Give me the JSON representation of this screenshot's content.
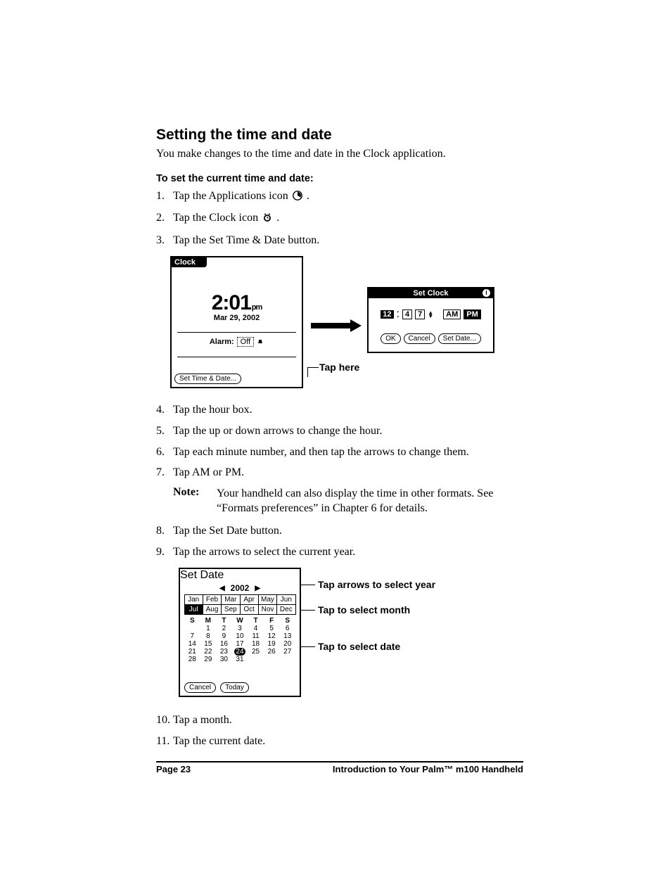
{
  "title": "Setting the time and date",
  "intro": "You make changes to the time and date in the Clock application.",
  "subheading": "To set the current time and date:",
  "steps_a": {
    "s1": "Tap the Applications icon ",
    "s1_end": ".",
    "s2": "Tap the Clock icon ",
    "s2_end": ".",
    "s3": "Tap the Set Time & Date button."
  },
  "clock_screen": {
    "title": "Clock",
    "time": "2:01",
    "ampm": "pm",
    "date": "Mar 29, 2002",
    "alarm_label": "Alarm:",
    "alarm_value": "Off",
    "button": "Set Time & Date..."
  },
  "setclock_screen": {
    "title": "Set Clock",
    "hour": "12",
    "min1": "4",
    "min2": "7",
    "am": "AM",
    "pm": "PM",
    "ok": "OK",
    "cancel": "Cancel",
    "setdate": "Set Date..."
  },
  "tap_here": "Tap here",
  "steps_b": {
    "s4": "Tap the hour box.",
    "s5": "Tap the up or down arrows to change the hour.",
    "s6": "Tap each minute number, and then tap the arrows to change them.",
    "s7": "Tap AM or PM."
  },
  "note": {
    "label": "Note:",
    "body": "Your handheld can also display the time in other formats. See “Formats preferences” in Chapter 6 for details."
  },
  "steps_c": {
    "s8": "Tap the Set Date button.",
    "s9": "Tap the arrows to select the current year."
  },
  "setdate_screen": {
    "title": "Set Date",
    "year": "2002",
    "months": [
      "Jan",
      "Feb",
      "Mar",
      "Apr",
      "May",
      "Jun",
      "Jul",
      "Aug",
      "Sep",
      "Oct",
      "Nov",
      "Dec"
    ],
    "selected_month_index": 6,
    "dow": [
      "S",
      "M",
      "T",
      "W",
      "T",
      "F",
      "S"
    ],
    "weeks": [
      [
        "",
        "1",
        "2",
        "3",
        "4",
        "5",
        "6"
      ],
      [
        "7",
        "8",
        "9",
        "10",
        "11",
        "12",
        "13"
      ],
      [
        "14",
        "15",
        "16",
        "17",
        "18",
        "19",
        "20"
      ],
      [
        "21",
        "22",
        "23",
        "24",
        "25",
        "26",
        "27"
      ],
      [
        "28",
        "29",
        "30",
        "31",
        "",
        "",
        ""
      ]
    ],
    "selected_day": "24",
    "cancel": "Cancel",
    "today": "Today"
  },
  "callouts": {
    "year": "Tap arrows to select year",
    "month": "Tap to select month",
    "date": "Tap to select date"
  },
  "steps_d": {
    "s10": "Tap a month.",
    "s11": "Tap the current date."
  },
  "footer": {
    "page": "Page 23",
    "title": "Introduction to Your Palm™ m100 Handheld"
  }
}
